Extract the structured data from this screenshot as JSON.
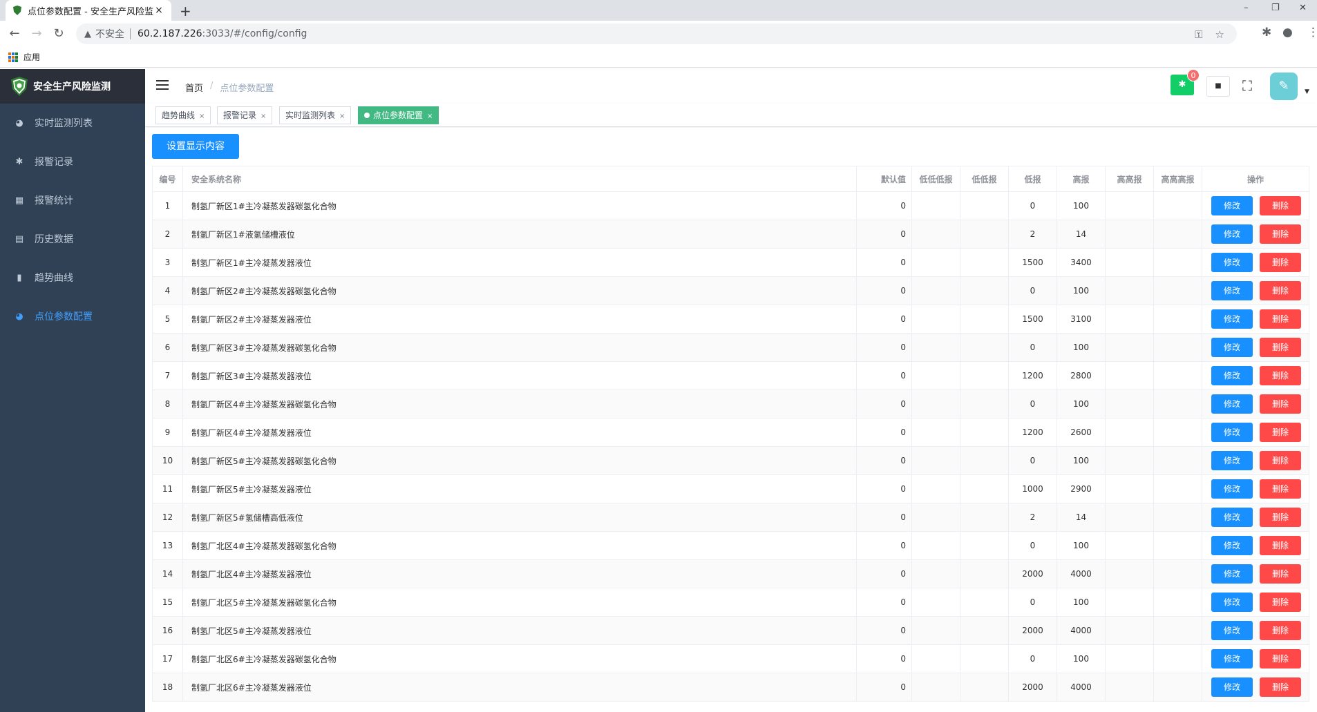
{
  "browser": {
    "tab_title": "点位参数配置 - 安全生产风险监测",
    "tab_close": "×",
    "new_tab": "+",
    "insecure_label": "不安全",
    "url_host": "60.2.187.226",
    "url_path": ":3033/#/config/config",
    "bookmark_apps": "应用"
  },
  "sidebar": {
    "title": "安全生产风险监测",
    "items": [
      {
        "label": "实时监测列表",
        "icon": "dashboard-icon"
      },
      {
        "label": "报警记录",
        "icon": "bug-icon"
      },
      {
        "label": "报警统计",
        "icon": "table-icon"
      },
      {
        "label": "历史数据",
        "icon": "document-icon"
      },
      {
        "label": "趋势曲线",
        "icon": "chart-icon"
      },
      {
        "label": "点位参数配置",
        "icon": "dashboard-icon"
      }
    ],
    "active_color": "#409eff",
    "bg_color": "#304156"
  },
  "header": {
    "breadcrumb_home": "首页",
    "breadcrumb_sep": "/",
    "breadcrumb_current": "点位参数配置",
    "badge_count": "0"
  },
  "tags": [
    {
      "label": "趋势曲线"
    },
    {
      "label": "报警记录"
    },
    {
      "label": "实时监测列表"
    },
    {
      "label": "点位参数配置"
    }
  ],
  "tag_close": "×",
  "main": {
    "settings_button": "设置显示内容"
  },
  "table": {
    "headers": {
      "id": "编号",
      "name": "安全系统名称",
      "default": "默认值",
      "lowlowlow": "低低低报",
      "lowlow": "低低报",
      "low": "低报",
      "high": "高报",
      "highhigh": "高高报",
      "highhighhigh": "高高高报",
      "ops": "操作"
    },
    "edit_label": "修改",
    "delete_label": "删除",
    "rows": [
      {
        "id": "1",
        "name": "制氢厂新区1#主冷凝蒸发器碳氢化合物",
        "default": "0",
        "low": "0",
        "high": "100"
      },
      {
        "id": "2",
        "name": "制氢厂新区1#液氢储槽液位",
        "default": "0",
        "low": "2",
        "high": "14"
      },
      {
        "id": "3",
        "name": "制氢厂新区1#主冷凝蒸发器液位",
        "default": "0",
        "low": "1500",
        "high": "3400"
      },
      {
        "id": "4",
        "name": "制氢厂新区2#主冷凝蒸发器碳氢化合物",
        "default": "0",
        "low": "0",
        "high": "100"
      },
      {
        "id": "5",
        "name": "制氢厂新区2#主冷凝蒸发器液位",
        "default": "0",
        "low": "1500",
        "high": "3100"
      },
      {
        "id": "6",
        "name": "制氢厂新区3#主冷凝蒸发器碳氢化合物",
        "default": "0",
        "low": "0",
        "high": "100"
      },
      {
        "id": "7",
        "name": "制氢厂新区3#主冷凝蒸发器液位",
        "default": "0",
        "low": "1200",
        "high": "2800"
      },
      {
        "id": "8",
        "name": "制氢厂新区4#主冷凝蒸发器碳氢化合物",
        "default": "0",
        "low": "0",
        "high": "100"
      },
      {
        "id": "9",
        "name": "制氢厂新区4#主冷凝蒸发器液位",
        "default": "0",
        "low": "1200",
        "high": "2600"
      },
      {
        "id": "10",
        "name": "制氢厂新区5#主冷凝蒸发器碳氢化合物",
        "default": "0",
        "low": "0",
        "high": "100"
      },
      {
        "id": "11",
        "name": "制氢厂新区5#主冷凝蒸发器液位",
        "default": "0",
        "low": "1000",
        "high": "2900"
      },
      {
        "id": "12",
        "name": "制氢厂新区5#氢储槽高低液位",
        "default": "0",
        "low": "2",
        "high": "14"
      },
      {
        "id": "13",
        "name": "制氢厂北区4#主冷凝蒸发器碳氢化合物",
        "default": "0",
        "low": "0",
        "high": "100"
      },
      {
        "id": "14",
        "name": "制氢厂北区4#主冷凝蒸发器液位",
        "default": "0",
        "low": "2000",
        "high": "4000"
      },
      {
        "id": "15",
        "name": "制氢厂北区5#主冷凝蒸发器碳氢化合物",
        "default": "0",
        "low": "0",
        "high": "100"
      },
      {
        "id": "16",
        "name": "制氢厂北区5#主冷凝蒸发器液位",
        "default": "0",
        "low": "2000",
        "high": "4000"
      },
      {
        "id": "17",
        "name": "制氢厂北区6#主冷凝蒸发器碳氢化合物",
        "default": "0",
        "low": "0",
        "high": "100"
      },
      {
        "id": "18",
        "name": "制氢厂北区6#主冷凝蒸发器液位",
        "default": "0",
        "low": "2000",
        "high": "4000"
      }
    ]
  }
}
